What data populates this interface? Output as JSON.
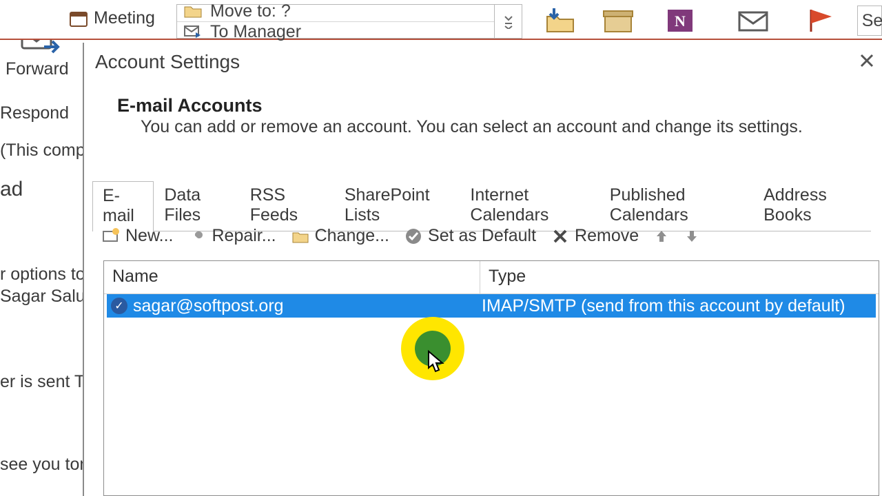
{
  "ribbon": {
    "forward": "Forward",
    "respond": "Respond",
    "meeting": "Meeting",
    "moveto": "Move to: ?",
    "tomanager": "To Manager",
    "se": "Se"
  },
  "left_fragments": {
    "f1": "(This comp",
    "f2": "ad",
    "f3": "r options to",
    "f4": "Sagar Salunl",
    "f5": "er is sent   T",
    "f6": "see you tom"
  },
  "dialog": {
    "title": "Account Settings",
    "heading": "E-mail Accounts",
    "desc": "You can add or remove an account. You can select an account and change its settings."
  },
  "tabs": [
    "E-mail",
    "Data Files",
    "RSS Feeds",
    "SharePoint Lists",
    "Internet Calendars",
    "Published Calendars",
    "Address Books"
  ],
  "toolbar": {
    "new": "New...",
    "repair": "Repair...",
    "change": "Change...",
    "setdefault": "Set as Default",
    "remove": "Remove"
  },
  "grid": {
    "col_name": "Name",
    "col_type": "Type",
    "row": {
      "name": "sagar@softpost.org",
      "type": "IMAP/SMTP (send from this account by default)"
    }
  }
}
